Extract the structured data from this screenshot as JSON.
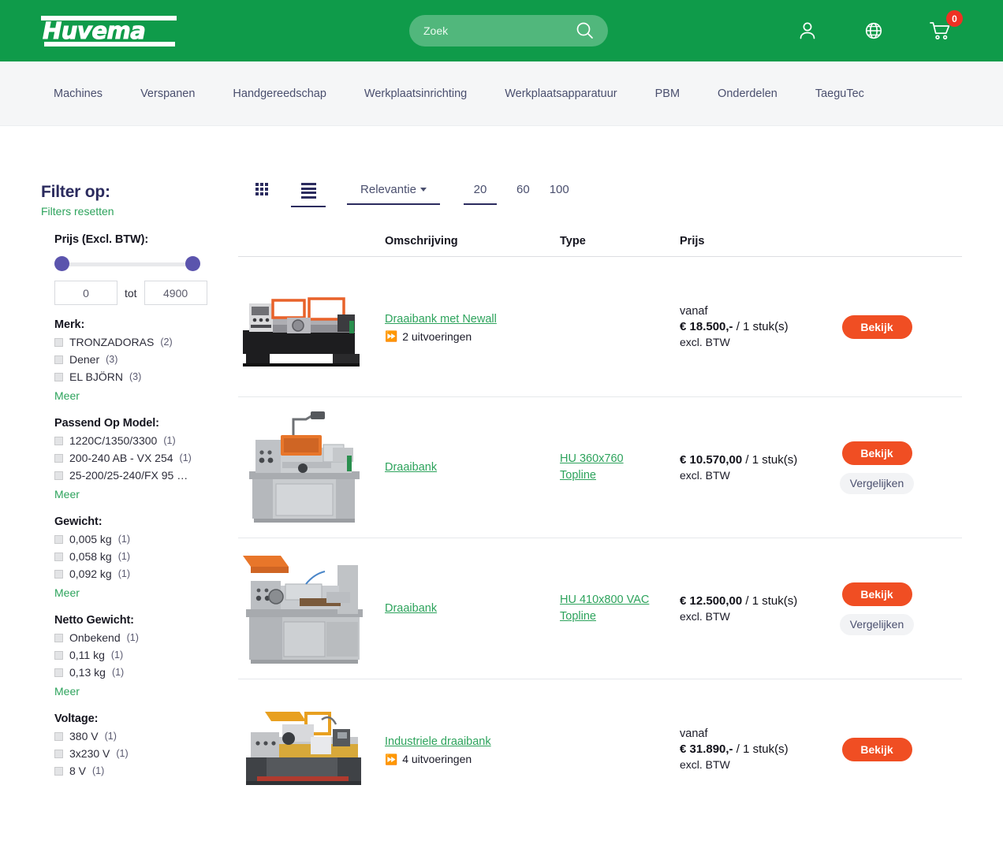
{
  "brand": {
    "name": "Huvema",
    "accent_green": "#0f9b4a",
    "accent_orange": "#f04e23",
    "link_green": "#2da35c",
    "navy": "#2b2b5e"
  },
  "header": {
    "search": {
      "placeholder": "Zoek",
      "value": "",
      "icon": "search-icon"
    },
    "icons": [
      {
        "name": "account-icon",
        "label": "Account"
      },
      {
        "name": "globe-icon",
        "label": "Taal"
      },
      {
        "name": "cart-icon",
        "label": "Winkelwagen",
        "badge": "0"
      }
    ]
  },
  "nav": {
    "items": [
      {
        "label": "Machines"
      },
      {
        "label": "Verspanen"
      },
      {
        "label": "Handgereedschap"
      },
      {
        "label": "Werkplaatsinrichting"
      },
      {
        "label": "Werkplaatsapparatuur"
      },
      {
        "label": "PBM"
      },
      {
        "label": "Onderdelen"
      },
      {
        "label": "TaeguTec"
      }
    ]
  },
  "sidebar": {
    "title": "Filter op:",
    "reset_label": "Filters resetten",
    "price": {
      "title": "Prijs (Excl. BTW):",
      "min_value": "0",
      "max_value": "4900",
      "between_label": "tot"
    },
    "more_label": "Meer",
    "groups": [
      {
        "title": "Merk:",
        "options": [
          {
            "label": "TRONZADORAS",
            "count": "(2)"
          },
          {
            "label": "Dener",
            "count": "(3)"
          },
          {
            "label": "EL BJÖRN",
            "count": "(3)"
          }
        ]
      },
      {
        "title": "Passend Op Model:",
        "options": [
          {
            "label": "1220C/1350/3300",
            "count": "(1)"
          },
          {
            "label": "200-240 AB - VX 254",
            "count": "(1)"
          },
          {
            "label": "25-200/25-240/FX 95 …",
            "count": ""
          }
        ]
      },
      {
        "title": "Gewicht:",
        "options": [
          {
            "label": "0,005 kg",
            "count": "(1)"
          },
          {
            "label": "0,058 kg",
            "count": "(1)"
          },
          {
            "label": "0,092 kg",
            "count": "(1)"
          }
        ]
      },
      {
        "title": "Netto Gewicht:",
        "options": [
          {
            "label": "Onbekend",
            "count": "(1)"
          },
          {
            "label": "0,11 kg",
            "count": "(1)"
          },
          {
            "label": "0,13 kg",
            "count": "(1)"
          }
        ]
      },
      {
        "title": "Voltage:",
        "options": [
          {
            "label": "380 V",
            "count": "(1)"
          },
          {
            "label": "3x230 V",
            "count": "(1)"
          },
          {
            "label": "8 V",
            "count": "(1)"
          }
        ]
      }
    ]
  },
  "toolbar": {
    "grid_view": "grid-view",
    "list_view": "list-view",
    "sort_label": "Relevantie",
    "per_page": [
      {
        "label": "20",
        "active": true
      },
      {
        "label": "60",
        "active": false
      },
      {
        "label": "100",
        "active": false
      }
    ]
  },
  "table": {
    "headers": {
      "image": "",
      "description": "Omschrijving",
      "type": "Type",
      "price": "Prijs",
      "action": ""
    },
    "rows": [
      {
        "image_alt": "Draaibank met Newall",
        "description": "Draaibank met Newall",
        "variants": "2 uitvoeringen",
        "type": "",
        "price_prefix": "vanaf",
        "price": "€ 18.500,-",
        "price_unit": "/ 1 stuk(s)",
        "price_note": "excl. BTW",
        "button": "Bekijk",
        "compare": ""
      },
      {
        "image_alt": "Draaibank HU 360x760 Topline",
        "description": "Draaibank",
        "variants": "",
        "type": "HU 360x760 Topline",
        "price_prefix": "",
        "price": "€ 10.570,00",
        "price_unit": "/ 1 stuk(s)",
        "price_note": "excl. BTW",
        "button": "Bekijk",
        "compare": "Vergelijken"
      },
      {
        "image_alt": "Draaibank HU 410x800 VAC Topline",
        "description": "Draaibank",
        "variants": "",
        "type": "HU 410x800 VAC Topline",
        "price_prefix": "",
        "price": "€ 12.500,00",
        "price_unit": "/ 1 stuk(s)",
        "price_note": "excl. BTW",
        "button": "Bekijk",
        "compare": "Vergelijken"
      },
      {
        "image_alt": "Industriele draaibank",
        "description": "Industriele draaibank",
        "variants": "4 uitvoeringen",
        "type": "",
        "price_prefix": "vanaf",
        "price": "€ 31.890,-",
        "price_unit": "/ 1 stuk(s)",
        "price_note": "excl. BTW",
        "button": "Bekijk",
        "compare": ""
      }
    ]
  }
}
